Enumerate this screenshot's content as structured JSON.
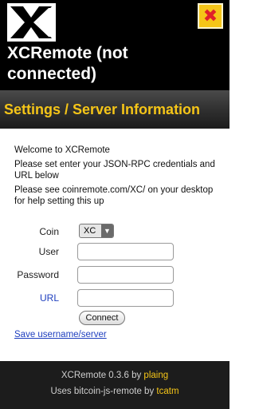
{
  "header": {
    "logo_icon": "xc-logo-icon",
    "title": "XCRemote (not connected)",
    "close_icon": "close-x-icon",
    "close_glyph": "✖"
  },
  "subheader": {
    "title": "Settings / Server Information"
  },
  "intro": {
    "welcome": "Welcome to XCRemote",
    "instructions": "Please set enter your JSON-RPC credentials and URL below",
    "help": "Please see coinremote.com/XC/ on your desktop for help setting this up"
  },
  "form": {
    "coin_label": "Coin",
    "coin_value": "XC",
    "user_label": "User",
    "user_value": "",
    "password_label": "Password",
    "password_value": "",
    "url_label": "URL",
    "url_value": "",
    "connect_label": "Connect"
  },
  "save_link": "Save username/server",
  "footer": {
    "version_prefix": "XCRemote 0.3.6 by ",
    "author": "plaing",
    "uses_prefix": "Uses bitcoin-js-remote by ",
    "uses_author": "tcatm"
  },
  "colors": {
    "accent_yellow": "#f5c518",
    "close_red": "#e0202a",
    "link_blue": "#1f3fbf",
    "header_bg": "#000000",
    "footer_bg": "#1c1c1c"
  }
}
